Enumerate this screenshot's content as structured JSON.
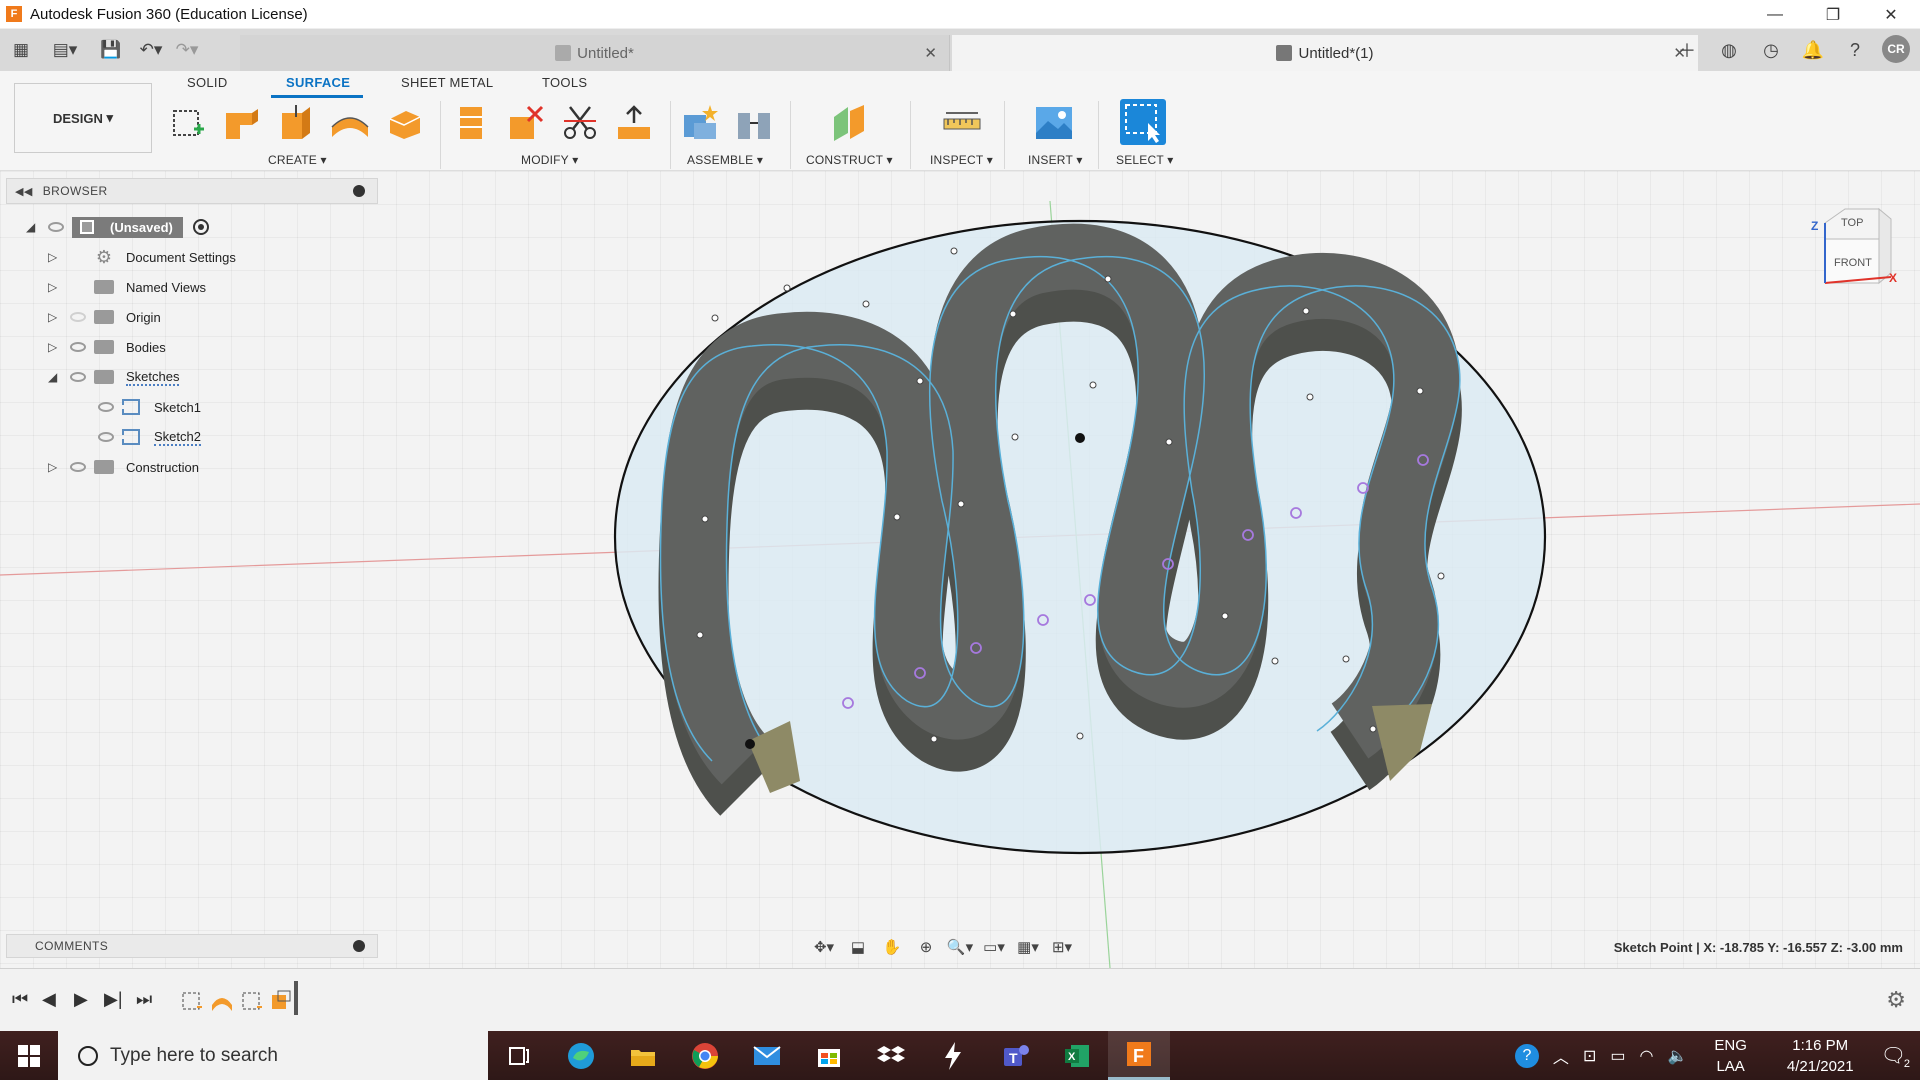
{
  "window": {
    "title": "Autodesk Fusion 360 (Education License)",
    "controls": [
      "—",
      "❐",
      "✕"
    ]
  },
  "tabs": [
    {
      "label": "Untitled*",
      "active": false
    },
    {
      "label": "Untitled*(1)",
      "active": true
    }
  ],
  "user": {
    "initials": "CR"
  },
  "ribbon": {
    "workspace": "DESIGN",
    "tabs": [
      "SOLID",
      "SURFACE",
      "SHEET METAL",
      "TOOLS"
    ],
    "active_tab": "SURFACE",
    "groups": [
      "CREATE",
      "MODIFY",
      "ASSEMBLE",
      "CONSTRUCT",
      "INSPECT",
      "INSERT",
      "SELECT"
    ]
  },
  "browser": {
    "title": "BROWSER",
    "root": "(Unsaved)",
    "items": [
      {
        "label": "Document Settings"
      },
      {
        "label": "Named Views"
      },
      {
        "label": "Origin"
      },
      {
        "label": "Bodies"
      },
      {
        "label": "Sketches"
      },
      {
        "label": "Sketch1"
      },
      {
        "label": "Sketch2"
      },
      {
        "label": "Construction"
      }
    ]
  },
  "viewcube": {
    "top": "TOP",
    "front": "FRONT",
    "axis_x": "X",
    "axis_z": "Z"
  },
  "comments": {
    "title": "COMMENTS"
  },
  "status": {
    "text": "Sketch Point | X: -18.785 Y: -16.557 Z: -3.00 mm"
  },
  "taskbar": {
    "search_placeholder": "Type here to search",
    "language": "ENG",
    "layout": "LAA",
    "time": "1:16 PM",
    "date": "4/21/2021",
    "notifications": "2"
  },
  "colors": {
    "accent": "#0b73c4",
    "body_gray": "#5a5c58",
    "plane_fill": "#dbeaf2",
    "taskbar": "#3a1c1b"
  }
}
